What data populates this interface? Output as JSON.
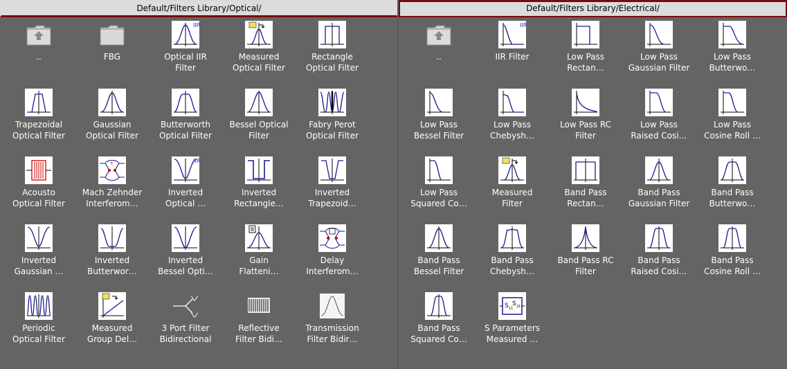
{
  "panels": {
    "optical": {
      "title": "Default/Filters Library/Optical/",
      "items": [
        {
          "label": "..",
          "icon": "folder-up-icon"
        },
        {
          "label": "FBG",
          "icon": "folder-icon"
        },
        {
          "label": "Optical IIR\nFilter",
          "icon": "iir-filter-icon"
        },
        {
          "label": "Measured\nOptical Filter",
          "icon": "measured-filter-icon"
        },
        {
          "label": "Rectangle\nOptical Filter",
          "icon": "rectangle-filter-icon"
        },
        {
          "label": "Trapezoidal\nOptical Filter",
          "icon": "trapezoidal-filter-icon"
        },
        {
          "label": "Gaussian\nOptical Filter",
          "icon": "gaussian-filter-icon"
        },
        {
          "label": "Butterworth\nOptical Filter",
          "icon": "butterworth-filter-icon"
        },
        {
          "label": "Bessel Optical\nFilter",
          "icon": "bessel-filter-icon"
        },
        {
          "label": "Fabry Perot\nOptical Filter",
          "icon": "fabry-perot-icon"
        },
        {
          "label": "Acousto\nOptical Filter",
          "icon": "acousto-optical-icon"
        },
        {
          "label": "Mach Zehnder\nInterferom…",
          "icon": "mach-zehnder-icon"
        },
        {
          "label": "Inverted\nOptical …",
          "icon": "inverted-iir-icon"
        },
        {
          "label": "Inverted\nRectangle…",
          "icon": "inverted-rectangle-icon"
        },
        {
          "label": "Inverted\nTrapezoid…",
          "icon": "inverted-trapezoid-icon"
        },
        {
          "label": "Inverted\nGaussian …",
          "icon": "inverted-gaussian-icon"
        },
        {
          "label": "Inverted\nButterwor…",
          "icon": "inverted-butterworth-icon"
        },
        {
          "label": "Inverted\nBessel Opti…",
          "icon": "inverted-bessel-icon"
        },
        {
          "label": "Gain\nFlatteni…",
          "icon": "gain-flattening-icon"
        },
        {
          "label": "Delay\nInterferom…",
          "icon": "delay-interferometer-icon"
        },
        {
          "label": "Periodic\nOptical Filter",
          "icon": "periodic-filter-icon"
        },
        {
          "label": "Measured\nGroup Del…",
          "icon": "measured-group-delay-icon"
        },
        {
          "label": "3 Port Filter\nBidirectional",
          "icon": "three-port-filter-icon"
        },
        {
          "label": "Reflective\nFilter Bidi…",
          "icon": "reflective-filter-icon"
        },
        {
          "label": "Transmission\nFilter Bidir…",
          "icon": "transmission-filter-icon"
        }
      ]
    },
    "electrical": {
      "title": "Default/Filters Library/Electrical/",
      "items": [
        {
          "label": "..",
          "icon": "folder-up-icon"
        },
        {
          "label": "IIR Filter",
          "icon": "iir-lowpass-icon"
        },
        {
          "label": "Low Pass\nRectan…",
          "icon": "lowpass-rectangle-icon"
        },
        {
          "label": "Low Pass\nGaussian Filter",
          "icon": "lowpass-gaussian-icon"
        },
        {
          "label": "Low Pass\nButterwo…",
          "icon": "lowpass-butterworth-icon"
        },
        {
          "label": "Low Pass\nBessel Filter",
          "icon": "lowpass-bessel-icon"
        },
        {
          "label": "Low Pass\nChebysh…",
          "icon": "lowpass-chebyshev-icon"
        },
        {
          "label": "Low Pass RC\nFilter",
          "icon": "lowpass-rc-icon"
        },
        {
          "label": "Low Pass\nRaised Cosi…",
          "icon": "lowpass-raised-cosine-icon"
        },
        {
          "label": "Low Pass\nCosine Roll …",
          "icon": "lowpass-cosine-rolloff-icon"
        },
        {
          "label": "Low Pass\nSquared Co…",
          "icon": "lowpass-squared-cosine-icon"
        },
        {
          "label": "Measured\nFilter",
          "icon": "measured-filter-icon"
        },
        {
          "label": "Band Pass\nRectan…",
          "icon": "bandpass-rectangle-icon"
        },
        {
          "label": "Band Pass\nGaussian Filter",
          "icon": "bandpass-gaussian-icon"
        },
        {
          "label": "Band Pass\nButterwo…",
          "icon": "bandpass-butterworth-icon"
        },
        {
          "label": "Band Pass\nBessel Filter",
          "icon": "bandpass-bessel-icon"
        },
        {
          "label": "Band Pass\nChebysh…",
          "icon": "bandpass-chebyshev-icon"
        },
        {
          "label": "Band Pass RC\nFilter",
          "icon": "bandpass-rc-icon"
        },
        {
          "label": "Band Pass\nRaised Cosi…",
          "icon": "bandpass-raised-cosine-icon"
        },
        {
          "label": "Band Pass\nCosine Roll …",
          "icon": "bandpass-cosine-rolloff-icon"
        },
        {
          "label": "Band Pass\nSquared Co…",
          "icon": "bandpass-squared-cosine-icon"
        },
        {
          "label": "S Parameters\nMeasured …",
          "icon": "s-parameters-icon"
        }
      ]
    }
  },
  "icon_badges": {
    "iir": "IIR",
    "s11": "S",
    "s21": "S",
    "sub11": "11",
    "sub21": "21"
  },
  "colors": {
    "background": "#646464",
    "header_bg": "#dcdcdc",
    "header_border": "#7a0a0a",
    "curve": "#1a1a8c",
    "accent_red": "#cc0000",
    "label_text": "#ffffff"
  }
}
